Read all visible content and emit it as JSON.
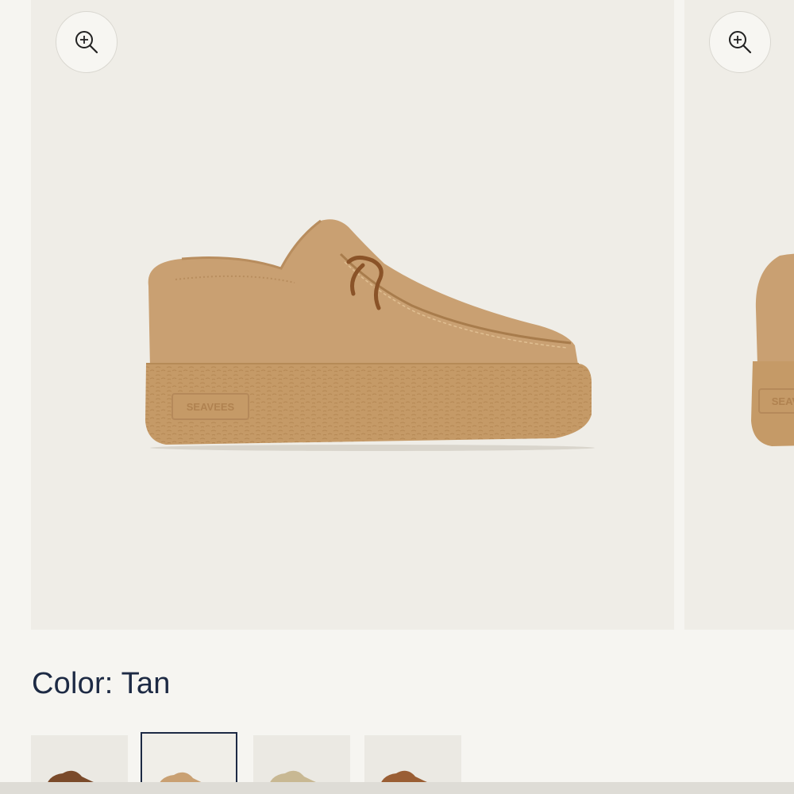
{
  "carousel": {
    "slides": [
      {
        "zoom_icon": "zoom-in-icon",
        "logo_text": "SEAVEES"
      },
      {
        "zoom_icon": "zoom-in-icon",
        "logo_text": "SEAVEES"
      }
    ]
  },
  "color": {
    "label": "Color:",
    "value": "Tan",
    "swatches": [
      {
        "name": "brown",
        "selected": false
      },
      {
        "name": "tan",
        "selected": true
      },
      {
        "name": "sand",
        "selected": false
      },
      {
        "name": "chestnut",
        "selected": false
      }
    ]
  },
  "colors": {
    "text": "#1d2a44",
    "suede": "#c9a072",
    "sole": "#c59a67",
    "background": "#efede7"
  }
}
